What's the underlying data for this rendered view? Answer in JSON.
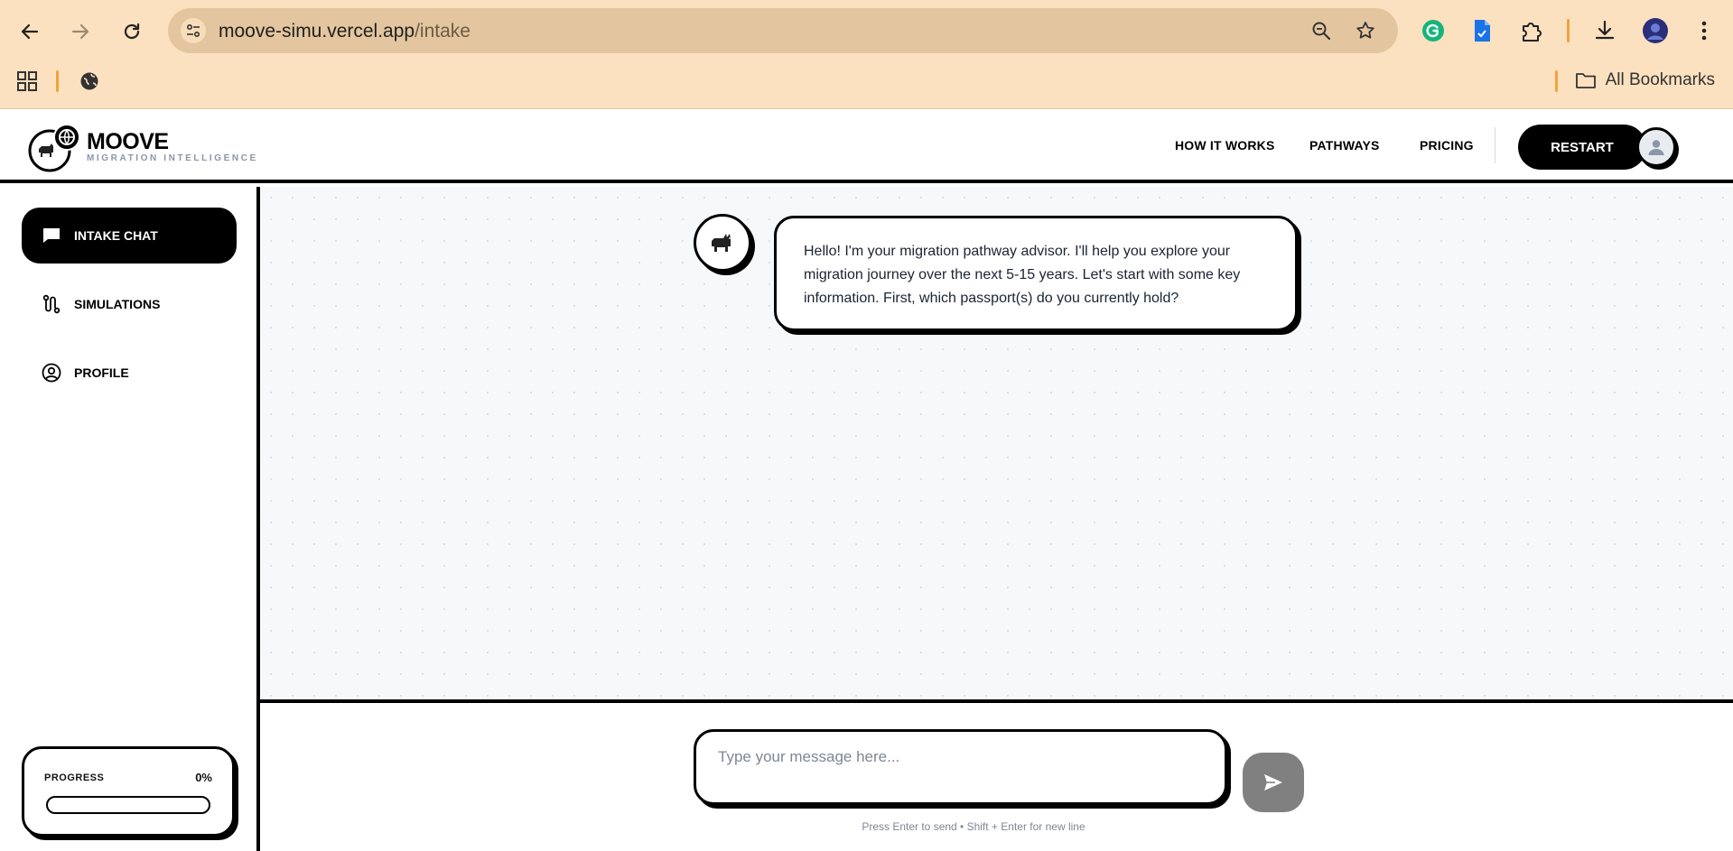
{
  "browser": {
    "url_host": "moove-simu.vercel.app",
    "url_path": "/intake",
    "all_bookmarks": "All Bookmarks"
  },
  "header": {
    "brand": "MOOVE",
    "tagline": "MIGRATION INTELLIGENCE",
    "nav": [
      "HOW IT WORKS",
      "PATHWAYS",
      "PRICING"
    ],
    "restart_label": "RESTART"
  },
  "sidebar": {
    "items": [
      {
        "label": "INTAKE CHAT",
        "icon": "chat-bubble-icon",
        "active": true
      },
      {
        "label": "SIMULATIONS",
        "icon": "route-icon",
        "active": false
      },
      {
        "label": "PROFILE",
        "icon": "user-circle-icon",
        "active": false
      }
    ],
    "progress": {
      "label": "PROGRESS",
      "value_text": "0%",
      "fraction": 0.0
    }
  },
  "chat": {
    "messages": [
      {
        "sender": "bot",
        "text": "Hello! I'm your migration pathway advisor. I'll help you explore your migration journey over the next 5-15 years. Let's start with some key information. First, which passport(s) do you currently hold?"
      }
    ]
  },
  "composer": {
    "placeholder": "Type your message here...",
    "hint": "Press Enter to send • Shift + Enter for new line"
  },
  "colors": {
    "chrome_bg": "#fbe1bf",
    "omnibox_bg": "#e3c69f",
    "accent_black": "#000000",
    "send_disabled": "#808080"
  }
}
